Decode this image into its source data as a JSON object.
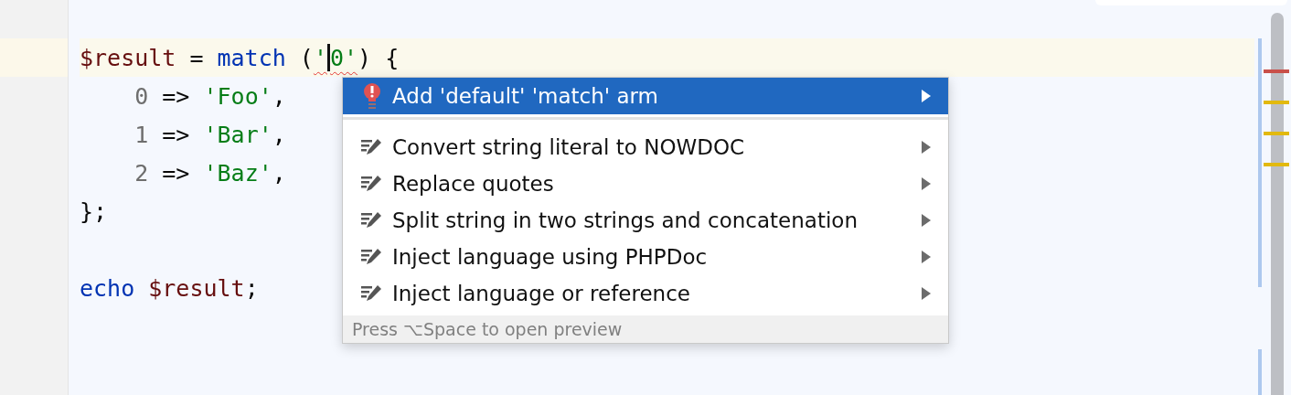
{
  "editor": {
    "lines": [
      {
        "current": false
      },
      {
        "current": true,
        "tokens": [
          {
            "text": "$result",
            "kind": "variable"
          },
          {
            "text": " = ",
            "kind": "plain"
          },
          {
            "text": "match",
            "kind": "keyword"
          },
          {
            "text": " (",
            "kind": "plain"
          },
          {
            "text": "'",
            "kind": "string",
            "error": true
          },
          {
            "kind": "caret"
          },
          {
            "text": "0'",
            "kind": "string",
            "error": true
          },
          {
            "text": ") {",
            "kind": "plain"
          }
        ]
      },
      {
        "current": false,
        "tokens": [
          {
            "text": "    0",
            "kind": "number"
          },
          {
            "text": " => ",
            "kind": "plain"
          },
          {
            "text": "'Foo'",
            "kind": "string"
          },
          {
            "text": ",",
            "kind": "plain"
          }
        ]
      },
      {
        "current": false,
        "tokens": [
          {
            "text": "    1",
            "kind": "number"
          },
          {
            "text": " => ",
            "kind": "plain"
          },
          {
            "text": "'Bar'",
            "kind": "string"
          },
          {
            "text": ",",
            "kind": "plain"
          }
        ]
      },
      {
        "current": false,
        "tokens": [
          {
            "text": "    2",
            "kind": "number"
          },
          {
            "text": " => ",
            "kind": "plain"
          },
          {
            "text": "'Baz'",
            "kind": "string"
          },
          {
            "text": ",",
            "kind": "plain"
          }
        ]
      },
      {
        "current": false,
        "tokens": [
          {
            "text": "};",
            "kind": "plain"
          }
        ]
      },
      {
        "current": false
      },
      {
        "current": false,
        "tokens": [
          {
            "text": "echo ",
            "kind": "keyword"
          },
          {
            "text": "$result",
            "kind": "variable"
          },
          {
            "text": ";",
            "kind": "plain"
          }
        ]
      }
    ],
    "error_stripe": [
      {
        "color": "#c9504a"
      },
      {
        "color": "#e2b90f"
      },
      {
        "color": "#e2b90f"
      },
      {
        "color": "#e2b90f"
      }
    ]
  },
  "popup": {
    "groups": [
      [
        {
          "label": "Add 'default' 'match' arm",
          "kind": "error",
          "selected": true
        }
      ],
      [
        {
          "label": "Convert string literal to NOWDOC",
          "kind": "intention",
          "selected": false
        },
        {
          "label": "Replace quotes",
          "kind": "intention",
          "selected": false
        },
        {
          "label": "Split string in two strings and concatenation",
          "kind": "intention",
          "selected": false
        },
        {
          "label": "Inject language using PHPDoc",
          "kind": "intention",
          "selected": false
        },
        {
          "label": "Inject language or reference",
          "kind": "intention",
          "selected": false
        }
      ]
    ],
    "footer": "Press ⌥Space to open preview"
  }
}
